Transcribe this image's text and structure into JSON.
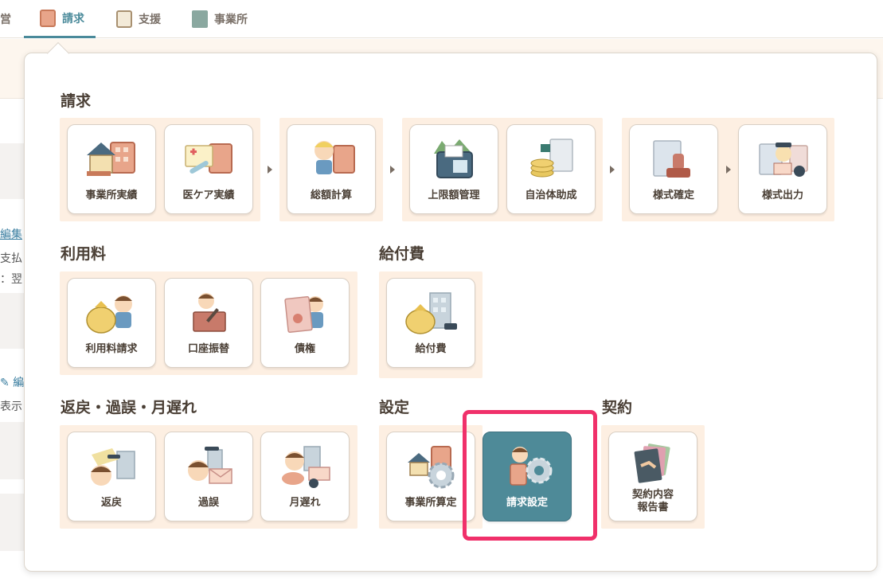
{
  "topnav": {
    "partial": "営",
    "tabs": [
      {
        "label": "請求"
      },
      {
        "label": "支援"
      },
      {
        "label": "事業所"
      }
    ]
  },
  "background": {
    "edit_link": "編集",
    "line1": "支払",
    "line2": "：翌",
    "edit2": "編",
    "line3": "表示"
  },
  "sections": {
    "billing": {
      "title": "請求",
      "tiles": [
        "事業所実績",
        "医ケア実績",
        "総額計算",
        "上限額管理",
        "自治体助成",
        "様式確定",
        "様式出力"
      ]
    },
    "usage_fee": {
      "title": "利用料",
      "tiles": [
        "利用料請求",
        "口座振替",
        "債権"
      ]
    },
    "benefit": {
      "title": "給付費",
      "tiles": [
        "給付費"
      ]
    },
    "returns": {
      "title": "返戻・過誤・月遅れ",
      "tiles": [
        "返戻",
        "過誤",
        "月遅れ"
      ]
    },
    "settings": {
      "title": "設定",
      "tiles": [
        "事業所算定",
        "請求設定"
      ]
    },
    "contract": {
      "title": "契約",
      "tiles": [
        "契約内容\n報告書"
      ]
    }
  },
  "colors": {
    "accent": "#4e8a98",
    "highlight": "#f0306a",
    "group_bg": "#fdefe2"
  }
}
